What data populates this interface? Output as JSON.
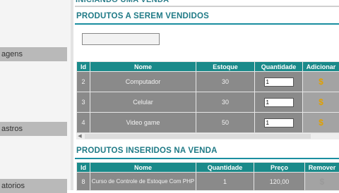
{
  "sidebar": {
    "items": [
      {
        "label": "agens"
      },
      {
        "label": "astros"
      },
      {
        "label": "atorios"
      }
    ]
  },
  "page": {
    "top_title": "INICIANDO UMA VENDA",
    "section1_title": "PRODUTOS A SEREM VENDIDOS",
    "section2_title": "PRODUTOS INSERIDOS NA VENDA"
  },
  "products_table": {
    "headers": [
      "Id",
      "Nome",
      "Estoque",
      "Quantidade",
      "Adicionar"
    ],
    "rows": [
      {
        "id": "2",
        "nome": "Computador",
        "estoque": "30",
        "quantidade": "1"
      },
      {
        "id": "3",
        "nome": "Celular",
        "estoque": "30",
        "quantidade": "1"
      },
      {
        "id": "4",
        "nome": "Video game",
        "estoque": "50",
        "quantidade": "1"
      }
    ]
  },
  "inserted_table": {
    "headers": [
      "Id",
      "Nome",
      "Quantidade",
      "Preço",
      "Remover"
    ],
    "rows": [
      {
        "id": "8",
        "nome": "Curso de Controle de Estoque Com PHP",
        "quantidade": "1",
        "preco": "120,00"
      }
    ]
  },
  "icons": {
    "add": "dollar-coin-icon",
    "remove": "dollar-coin-gray-icon"
  },
  "colors": {
    "header_teal": "#1a8a8a",
    "title_teal": "#1f7a86",
    "row_gray": "#8a8a8a",
    "coin_gold": "#e0a000"
  }
}
